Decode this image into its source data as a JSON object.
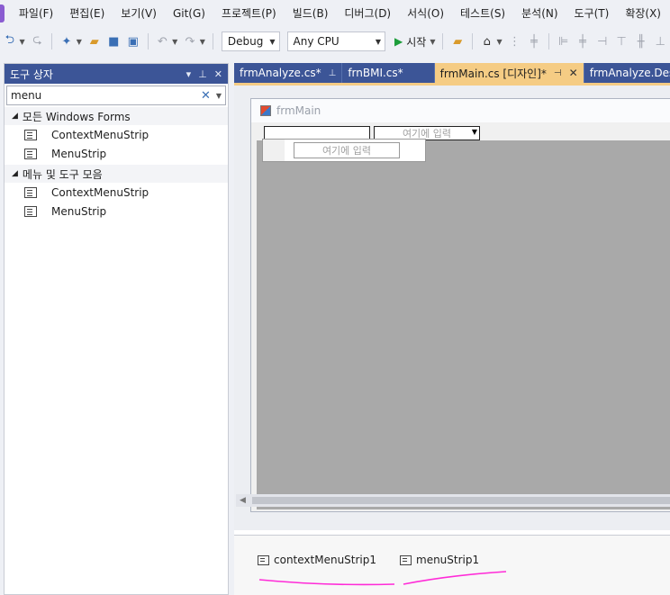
{
  "menubar": {
    "items": [
      "파일(F)",
      "편집(E)",
      "보기(V)",
      "Git(G)",
      "프로젝트(P)",
      "빌드(B)",
      "디버그(D)",
      "서식(O)",
      "테스트(S)",
      "분석(N)",
      "도구(T)",
      "확장(X)"
    ]
  },
  "toolbar": {
    "config": "Debug",
    "platform": "Any CPU",
    "start_label": "시작"
  },
  "toolbox": {
    "title": "도구 상자",
    "search_value": "menu",
    "groups": [
      {
        "label": "모든 Windows Forms",
        "items": [
          "ContextMenuStrip",
          "MenuStrip"
        ]
      },
      {
        "label": "메뉴 및 도구 모음",
        "items": [
          "ContextMenuStrip",
          "MenuStrip"
        ]
      }
    ]
  },
  "tabs": [
    {
      "label": "frmAnalyze.cs*"
    },
    {
      "label": "frnBMI.cs*"
    },
    {
      "label": "frmMain.cs [디자인]*"
    },
    {
      "label": "frmAnalyze.Designer.cs"
    }
  ],
  "form": {
    "title": "frmMain",
    "combo_placeholder": "여기에 입력",
    "context_item_placeholder": "여기에 입력"
  },
  "tray": {
    "components": [
      "contextMenuStrip1",
      "menuStrip1"
    ]
  },
  "colors": {
    "accent": "#3c5597",
    "active_tab": "#f5cc84",
    "annotation": "#ff2bd8"
  }
}
